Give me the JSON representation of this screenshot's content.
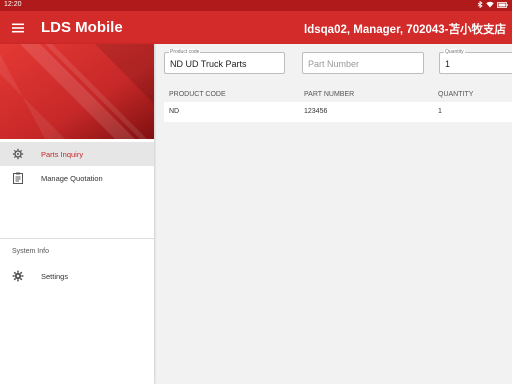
{
  "status_bar": {
    "time": "12:20"
  },
  "app_bar": {
    "title": "LDS Mobile",
    "user_info": "ldsqa02, Manager, 702043-苫小牧支店"
  },
  "colors": {
    "primary": "#d32a2a",
    "status_bar": "#b01a1a",
    "active_text": "#c62828"
  },
  "drawer": {
    "items": [
      {
        "label": "Parts Inquiry",
        "icon": "gear-icon",
        "active": true
      },
      {
        "label": "Manage Quotation",
        "icon": "clipboard-icon",
        "active": false
      }
    ],
    "section_label": "System Info",
    "system_items": [
      {
        "label": "Settings",
        "icon": "settings-icon"
      }
    ]
  },
  "search": {
    "product_code": {
      "label": "Product code",
      "value": "ND  UD Truck Parts"
    },
    "part_number": {
      "placeholder": "Part Number"
    },
    "quantity": {
      "label": "Quantity",
      "value": "1"
    }
  },
  "table": {
    "headers": [
      "PRODUCT CODE",
      "PART NUMBER",
      "QUANTITY"
    ],
    "rows": [
      [
        "ND",
        "123456",
        "1"
      ]
    ]
  }
}
